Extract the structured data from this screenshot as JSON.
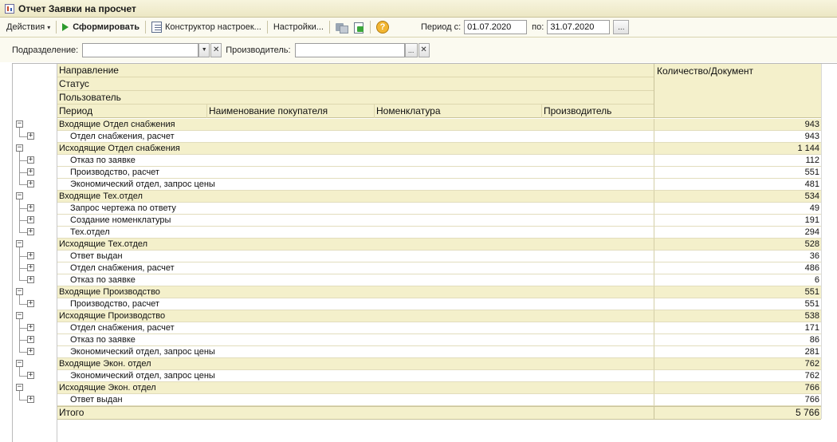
{
  "window": {
    "title": "Отчет  Заявки на просчет"
  },
  "toolbar": {
    "actions_label": "Действия",
    "generate_label": "Сформировать",
    "constructor_label": "Конструктор настроек...",
    "settings_label": "Настройки...",
    "help_glyph": "?",
    "period_from_label": "Период с:",
    "period_from_value": "01.07.2020",
    "period_to_label": "по:",
    "period_to_value": "31.07.2020",
    "period_more_glyph": "..."
  },
  "filters": {
    "division_label": "Подразделение:",
    "division_value": "",
    "manufacturer_label": "Производитель:",
    "manufacturer_value": "",
    "dropdown_glyph": "▼",
    "clear_glyph": "✕",
    "choose_glyph": "..."
  },
  "report": {
    "header": {
      "direction": "Направление",
      "status": "Статус",
      "user": "Пользователь",
      "period": "Период",
      "customer_name": "Наименование покупателя",
      "nomenclature": "Номенклатура",
      "manufacturer": "Производитель",
      "quantity": "Количество/Документ"
    },
    "expand_glyph": "+",
    "collapse_glyph": "−",
    "rows": [
      {
        "level": 0,
        "label": "Входящие Отдел снабжения",
        "value": "943"
      },
      {
        "level": 1,
        "label": "Отдел снабжения, расчет",
        "value": "943"
      },
      {
        "level": 0,
        "label": "Исходящие Отдел снабжения",
        "value": "1 144"
      },
      {
        "level": 1,
        "label": "Отказ по заявке",
        "value": "112"
      },
      {
        "level": 1,
        "label": "Производство, расчет",
        "value": "551"
      },
      {
        "level": 1,
        "label": "Экономический отдел, запрос цены",
        "value": "481"
      },
      {
        "level": 0,
        "label": "Входящие Тех.отдел",
        "value": "534"
      },
      {
        "level": 1,
        "label": "Запрос чертежа по ответу",
        "value": "49"
      },
      {
        "level": 1,
        "label": "Создание номенклатуры",
        "value": "191"
      },
      {
        "level": 1,
        "label": "Тех.отдел",
        "value": "294"
      },
      {
        "level": 0,
        "label": "Исходящие Тех.отдел",
        "value": "528"
      },
      {
        "level": 1,
        "label": "Ответ выдан",
        "value": "36"
      },
      {
        "level": 1,
        "label": "Отдел снабжения, расчет",
        "value": "486"
      },
      {
        "level": 1,
        "label": "Отказ по заявке",
        "value": "6"
      },
      {
        "level": 0,
        "label": "Входящие Производство",
        "value": "551"
      },
      {
        "level": 1,
        "label": "Производство, расчет",
        "value": "551"
      },
      {
        "level": 0,
        "label": "Исходящие Производство",
        "value": "538"
      },
      {
        "level": 1,
        "label": "Отдел снабжения, расчет",
        "value": "171"
      },
      {
        "level": 1,
        "label": "Отказ по заявке",
        "value": "86"
      },
      {
        "level": 1,
        "label": "Экономический отдел, запрос цены",
        "value": "281"
      },
      {
        "level": 0,
        "label": "Входящие Экон. отдел",
        "value": "762"
      },
      {
        "level": 1,
        "label": "Экономический отдел, запрос цены",
        "value": "762"
      },
      {
        "level": 0,
        "label": "Исходящие Экон. отдел",
        "value": "766"
      },
      {
        "level": 1,
        "label": "Ответ выдан",
        "value": "766"
      }
    ],
    "total": {
      "label": "Итого",
      "value": "5 766"
    }
  }
}
